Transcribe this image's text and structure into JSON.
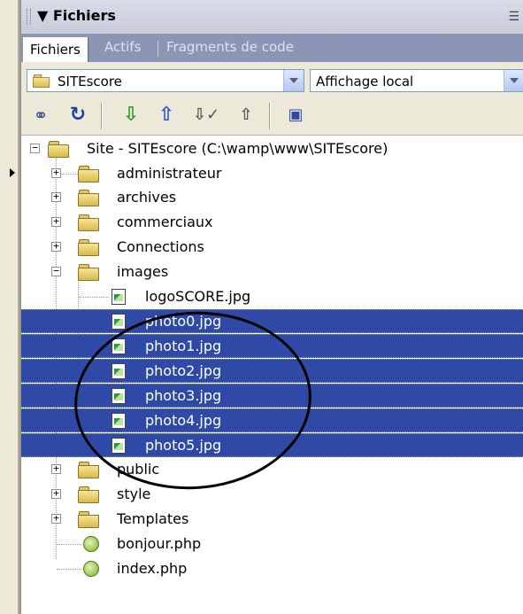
{
  "panel": {
    "title": "Fichiers"
  },
  "tabs": [
    "Fichiers",
    "Actifs",
    "Fragments de code"
  ],
  "site_select": {
    "value": "SITEscore"
  },
  "view_select": {
    "value": "Affichage local"
  },
  "toolbar_icons": [
    "connect-icon",
    "refresh-icon",
    "get-icon",
    "put-icon",
    "checkout-icon",
    "checkin-icon",
    "expand-icon"
  ],
  "tree": {
    "root": "Site - SITEscore (C:\\wamp\\www\\SITEscore)",
    "items": [
      {
        "label": "administrateur"
      },
      {
        "label": "archives"
      },
      {
        "label": "commerciaux"
      },
      {
        "label": "Connections"
      },
      {
        "label": "images"
      },
      {
        "label": "logoSCORE.jpg"
      },
      {
        "label": "photo0.jpg"
      },
      {
        "label": "photo1.jpg"
      },
      {
        "label": "photo2.jpg"
      },
      {
        "label": "photo3.jpg"
      },
      {
        "label": "photo4.jpg"
      },
      {
        "label": "photo5.jpg"
      },
      {
        "label": "public"
      },
      {
        "label": "style"
      },
      {
        "label": "Templates"
      },
      {
        "label": "bonjour.php"
      },
      {
        "label": "index.php"
      }
    ]
  },
  "colors": {
    "selection": "#2f4aa6",
    "tabbar": "#8a96b3",
    "toolbar": "#ece9d8"
  }
}
